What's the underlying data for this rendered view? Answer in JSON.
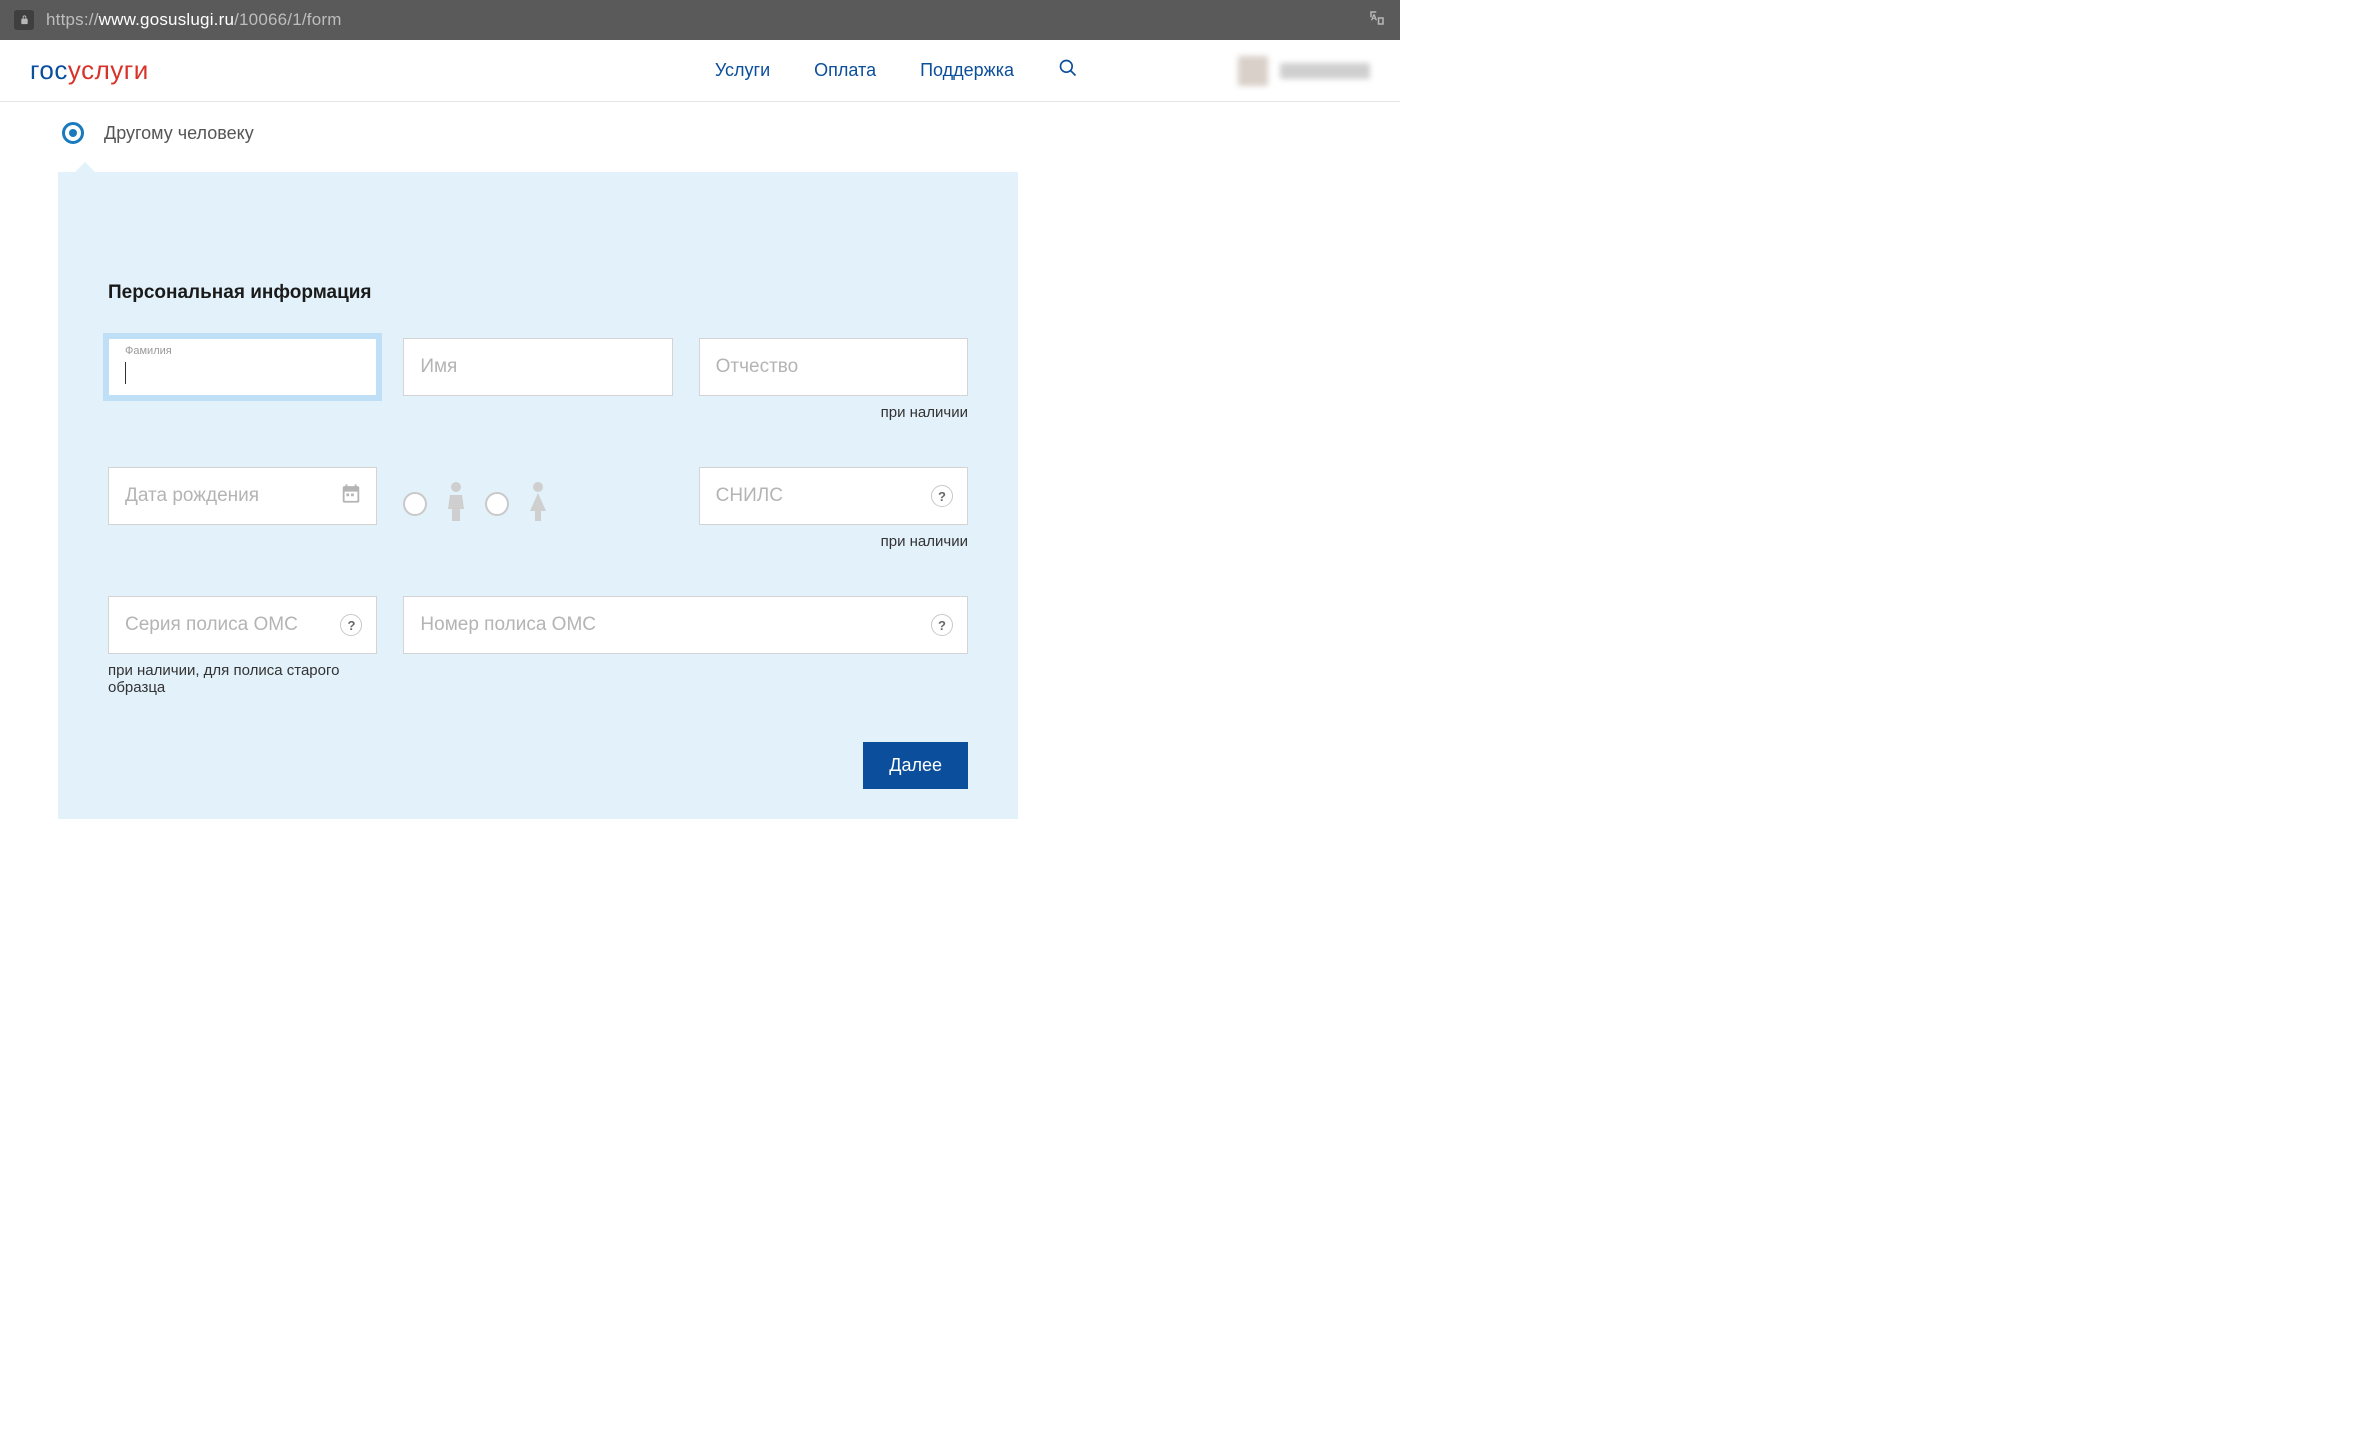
{
  "browser": {
    "url_prefix": "https://",
    "url_host": "www.gosuslugi.ru",
    "url_path": "/10066/1/form"
  },
  "header": {
    "logo_part1": "гос",
    "logo_part2": "услуги",
    "nav": {
      "services": "Услуги",
      "payment": "Оплата",
      "support": "Поддержка"
    }
  },
  "radio": {
    "other_person": "Другому человеку"
  },
  "form": {
    "section_title": "Персональная информация",
    "surname_label": "Фамилия",
    "name_placeholder": "Имя",
    "patronymic_placeholder": "Отчество",
    "optional_hint": "при наличии",
    "birthdate_placeholder": "Дата рождения",
    "snils_placeholder": "СНИЛС",
    "oms_series_placeholder": "Серия полиса ОМС",
    "oms_series_hint": "при наличии, для полиса старого образца",
    "oms_number_placeholder": "Номер полиса ОМС",
    "submit": "Далее",
    "help_symbol": "?"
  }
}
